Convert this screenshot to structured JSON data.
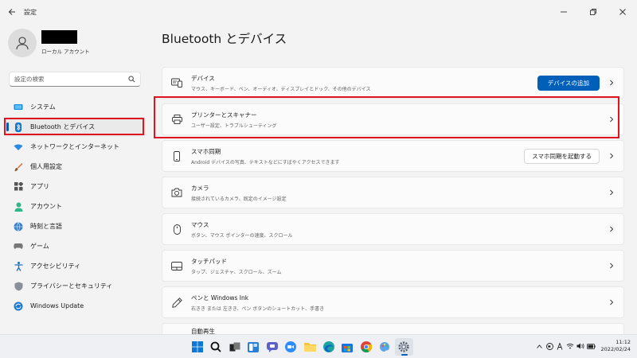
{
  "app": {
    "title": "設定"
  },
  "profile": {
    "account_type": "ローカル アカウント"
  },
  "search": {
    "placeholder": "設定の検索"
  },
  "sidebar": {
    "items": [
      {
        "label": "システム",
        "icon": "monitor-icon"
      },
      {
        "label": "Bluetooth とデバイス",
        "icon": "bluetooth-icon",
        "active": true
      },
      {
        "label": "ネットワークとインターネット",
        "icon": "wifi-icon"
      },
      {
        "label": "個人用設定",
        "icon": "brush-icon"
      },
      {
        "label": "アプリ",
        "icon": "apps-icon"
      },
      {
        "label": "アカウント",
        "icon": "person-icon"
      },
      {
        "label": "時刻と言語",
        "icon": "globe-clock-icon"
      },
      {
        "label": "ゲーム",
        "icon": "controller-icon"
      },
      {
        "label": "アクセシビリティ",
        "icon": "accessibility-icon"
      },
      {
        "label": "プライバシーとセキュリティ",
        "icon": "shield-icon"
      },
      {
        "label": "Windows Update",
        "icon": "update-icon"
      }
    ]
  },
  "main": {
    "title": "Bluetooth とデバイス",
    "cards": [
      {
        "title": "デバイス",
        "subtitle": "マウス、キーボード、ペン、オーディオ、ディスプレイとドック、その他のデバイス",
        "icon": "devices-icon",
        "button": "デバイスの追加"
      },
      {
        "title": "プリンターとスキャナー",
        "subtitle": "ユーザー設定、トラブルシューティング",
        "icon": "printer-icon"
      },
      {
        "title": "スマホ同期",
        "subtitle": "Android デバイスの写真、テキストなどにすばやくアクセスできます",
        "icon": "phone-icon",
        "button": "スマホ同期を起動する"
      },
      {
        "title": "カメラ",
        "subtitle": "接続されているカメラ、既定のイメージ設定",
        "icon": "camera-icon"
      },
      {
        "title": "マウス",
        "subtitle": "ボタン、マウス ポインターの速度、スクロール",
        "icon": "mouse-icon"
      },
      {
        "title": "タッチパッド",
        "subtitle": "タップ、ジェスチャ、スクロール、ズーム",
        "icon": "touchpad-icon"
      },
      {
        "title": "ペンと Windows Ink",
        "subtitle": "右きき または 左きき、ペン ボタンのショートカット、手書き",
        "icon": "pen-icon"
      },
      {
        "title": "自動再生",
        "subtitle": "",
        "icon": "autoplay-icon"
      }
    ]
  },
  "taskbar": {
    "apps": [
      "windows-start-icon",
      "search-icon",
      "task-view-icon",
      "widgets-icon",
      "teams-chat-icon",
      "zoom-icon",
      "file-explorer-icon",
      "edge-icon",
      "store-icon",
      "chrome-icon",
      "paint-icon",
      "settings-icon"
    ],
    "time": "11:12",
    "date": "2022/02/24"
  },
  "colors": {
    "accent": "#005fb8",
    "highlight": "#e0141e"
  }
}
